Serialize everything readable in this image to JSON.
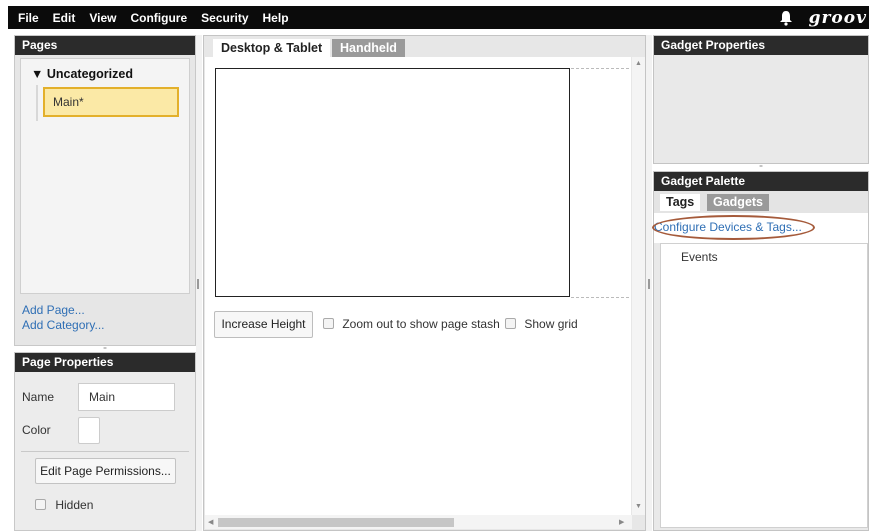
{
  "menubar": {
    "items": [
      "File",
      "Edit",
      "View",
      "Configure",
      "Security",
      "Help"
    ],
    "logo_text": "groov"
  },
  "pages_panel": {
    "title": "Pages",
    "group_label": "▼ Uncategorized",
    "page_item": "Main*",
    "add_page": "Add Page...",
    "add_category": "Add Category..."
  },
  "page_properties": {
    "title": "Page Properties",
    "name_label": "Name",
    "name_value": "Main",
    "color_label": "Color",
    "permissions_button": "Edit Page Permissions...",
    "hidden_label": "Hidden"
  },
  "center": {
    "tabs": [
      "Desktop & Tablet",
      "Handheld"
    ],
    "increase_height": "Increase Height",
    "zoom_option": "Zoom out to show page stash",
    "grid_option": "Show grid"
  },
  "gadget_properties": {
    "title": "Gadget Properties"
  },
  "gadget_palette": {
    "title": "Gadget Palette",
    "tabs": [
      "Tags",
      "Gadgets"
    ],
    "configure_link": "Configure Devices & Tags...",
    "items": [
      "Events"
    ]
  },
  "colors": {
    "menubar_bg": "#0b0b0b",
    "panel_header_bg": "#2b2b2b",
    "selected_page_bg": "#fbe9a6",
    "selected_page_border": "#e3b02b",
    "link": "#2f6fb5",
    "highlight_ellipse": "#a55a3a"
  }
}
